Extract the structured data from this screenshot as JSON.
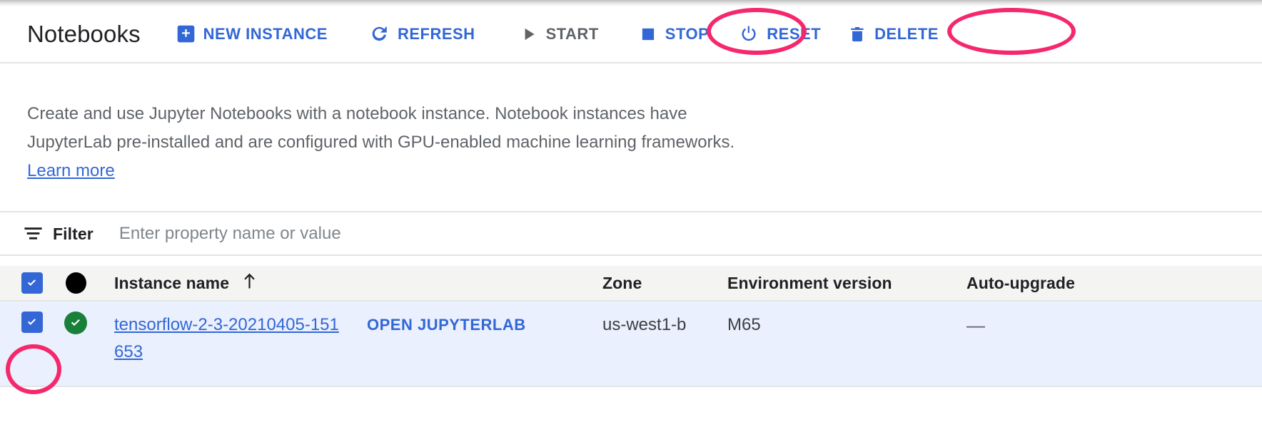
{
  "page": {
    "title": "Notebooks"
  },
  "toolbar": {
    "buttons": [
      {
        "label": "NEW INSTANCE",
        "icon": "add-box-icon",
        "state": "enabled",
        "highlighted": false
      },
      {
        "label": "REFRESH",
        "icon": "refresh-icon",
        "state": "enabled",
        "highlighted": false
      },
      {
        "label": "START",
        "icon": "play-icon",
        "state": "disabled",
        "highlighted": false
      },
      {
        "label": "STOP",
        "icon": "stop-icon",
        "state": "enabled",
        "highlighted": true
      },
      {
        "label": "RESET",
        "icon": "power-icon",
        "state": "enabled",
        "highlighted": false
      },
      {
        "label": "DELETE",
        "icon": "trash-icon",
        "state": "enabled",
        "highlighted": true
      }
    ]
  },
  "description": {
    "line1": "Create and use Jupyter Notebooks with a notebook instance. Notebook instances have",
    "line2": "JupyterLab pre-installed and are configured with GPU-enabled machine learning",
    "line3": "frameworks. ",
    "link_label": "Learn more"
  },
  "filter": {
    "icon": "filter-list-icon",
    "label": "Filter",
    "value": "",
    "placeholder": "Enter property name or value"
  },
  "table": {
    "header": {
      "select_all_checkbox": "checked",
      "status_icon": "status-dot-icon",
      "columns": [
        {
          "key": "name",
          "label": "Instance name",
          "sort": "ascending",
          "sort_icon": "arrow-up-icon"
        },
        {
          "key": "zone",
          "label": "Zone"
        },
        {
          "key": "env",
          "label": "Environment version"
        },
        {
          "key": "auto",
          "label": "Auto-upgrade"
        }
      ]
    },
    "rows": [
      {
        "selected": true,
        "checkbox_highlighted": true,
        "status": "running",
        "status_icon": "check-circle-icon",
        "name": "tensorflow-2-3-20210405-151653",
        "action_label": "OPEN JUPYTERLAB",
        "zone": "us-west1-b",
        "environment_version": "M65",
        "auto_upgrade": "—"
      }
    ]
  },
  "colors": {
    "link": "#3367d6",
    "annotation": "#f5286b",
    "selected_row": "#eaf0fd",
    "header_row": "#f4f4f3",
    "status_ok": "#188038",
    "disabled_text": "#5f6368"
  }
}
